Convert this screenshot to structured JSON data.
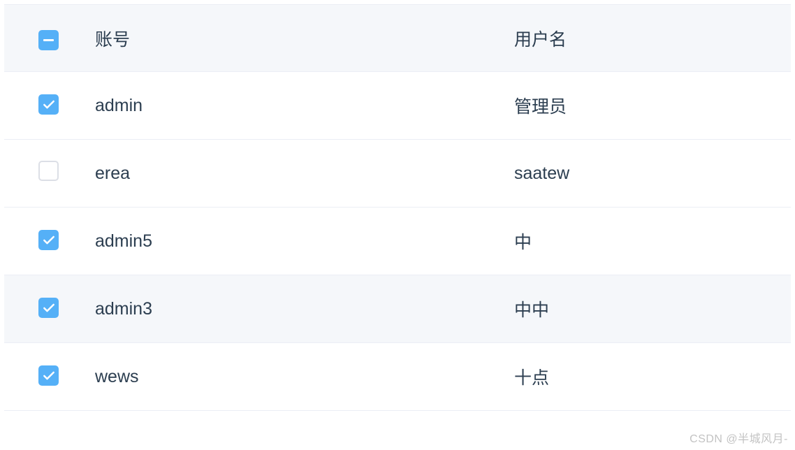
{
  "table": {
    "header": {
      "checkbox_state": "indeterminate",
      "account_label": "账号",
      "username_label": "用户名"
    },
    "rows": [
      {
        "checked": true,
        "account": "admin",
        "username": "管理员",
        "hover": false
      },
      {
        "checked": false,
        "account": "erea",
        "username": "saatew",
        "hover": false
      },
      {
        "checked": true,
        "account": "admin5",
        "username": "中",
        "hover": false
      },
      {
        "checked": true,
        "account": "admin3",
        "username": "中中",
        "hover": true
      },
      {
        "checked": true,
        "account": "wews",
        "username": "十点",
        "hover": false
      }
    ]
  },
  "watermark": "CSDN @半城风月-"
}
